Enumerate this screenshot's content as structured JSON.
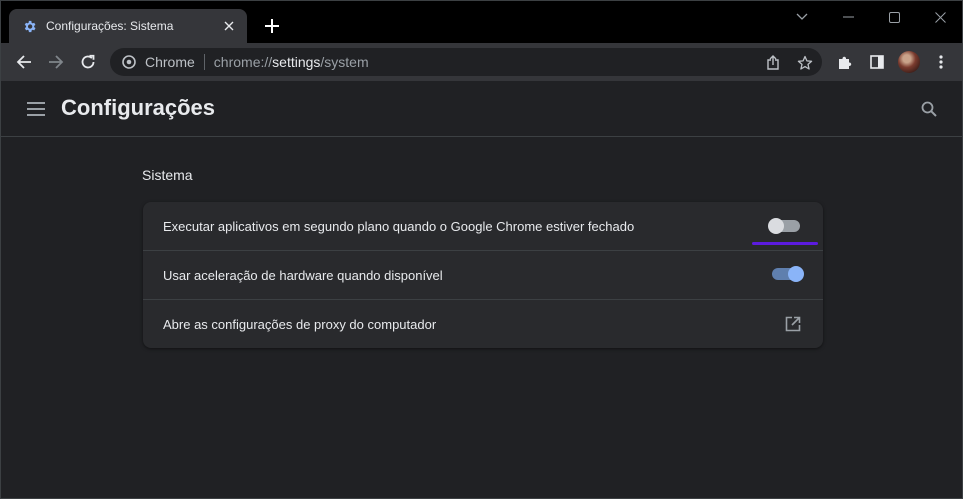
{
  "tab": {
    "title": "Configurações: Sistema",
    "favicon": "gear-icon"
  },
  "omnibox": {
    "chip": "Chrome",
    "url_prefix": "chrome://",
    "url_host": "settings",
    "url_path": "/system"
  },
  "header": {
    "title": "Configurações"
  },
  "section": {
    "title": "Sistema"
  },
  "settings": [
    {
      "label": "Executar aplicativos em segundo plano quando o Google Chrome estiver fechado",
      "control": "toggle",
      "state": "off"
    },
    {
      "label": "Usar aceleração de hardware quando disponível",
      "control": "toggle",
      "state": "on"
    },
    {
      "label": "Abre as configurações de proxy do computador",
      "control": "open-in-new-icon"
    }
  ],
  "colors": {
    "accent": "#8ab4f8",
    "focus": "#5c1be0",
    "background": "#202124",
    "card": "#292a2d"
  }
}
